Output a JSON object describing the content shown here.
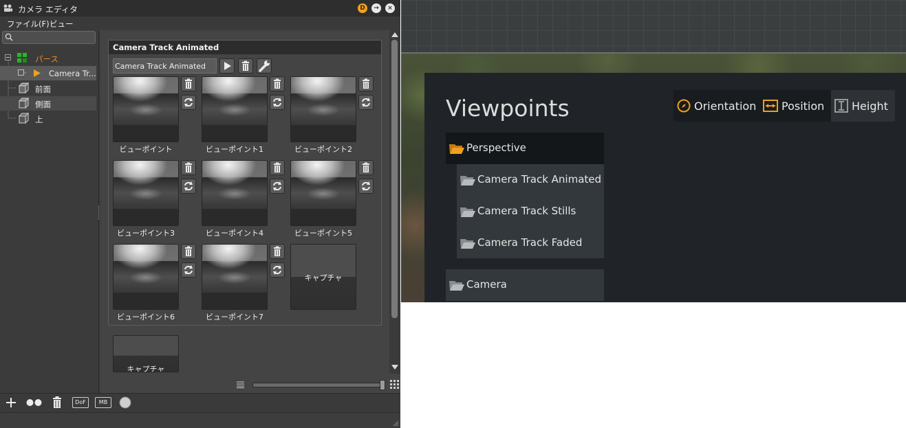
{
  "window": {
    "title": "カメラ エディタ",
    "title_buttons": [
      "D",
      "→",
      "×"
    ]
  },
  "menu": {
    "file": "ファイル(F)",
    "view": "ビュー"
  },
  "tree": {
    "search_placeholder": "",
    "items": [
      {
        "label": "パース",
        "color": "#f08a24"
      },
      {
        "label": "Camera Tr...",
        "color": "#eaeaea"
      },
      {
        "label": "前面",
        "color": "#eaeaea"
      },
      {
        "label": "側面",
        "color": "#eaeaea"
      },
      {
        "label": "上",
        "color": "#eaeaea"
      }
    ]
  },
  "group": {
    "title": "Camera Track Animated",
    "name_value": "Camera Track Animated"
  },
  "viewpoints": [
    "ビューポイント",
    "ビューポイント1",
    "ビューポイント2",
    "ビューポイント3",
    "ビューポイント4",
    "ビューポイント5",
    "ビューポイント6",
    "ビューポイント7"
  ],
  "capture_label": "キャプチャ",
  "bottom_toolbar": {
    "dof": "DoF",
    "mb": "MB"
  },
  "viewport": {
    "title": "Viewpoints",
    "tabs": [
      {
        "label": "Orientation",
        "icon": "compass-icon"
      },
      {
        "label": "Position",
        "icon": "position-icon"
      },
      {
        "label": "Height",
        "icon": "height-icon"
      }
    ],
    "folders": [
      {
        "label": "Perspective",
        "open": true
      },
      {
        "label": "Camera Track Animated"
      },
      {
        "label": "Camera Track Stills"
      },
      {
        "label": "Camera Track Faded"
      },
      {
        "label": "Camera"
      }
    ],
    "accent": "#f0a020"
  }
}
